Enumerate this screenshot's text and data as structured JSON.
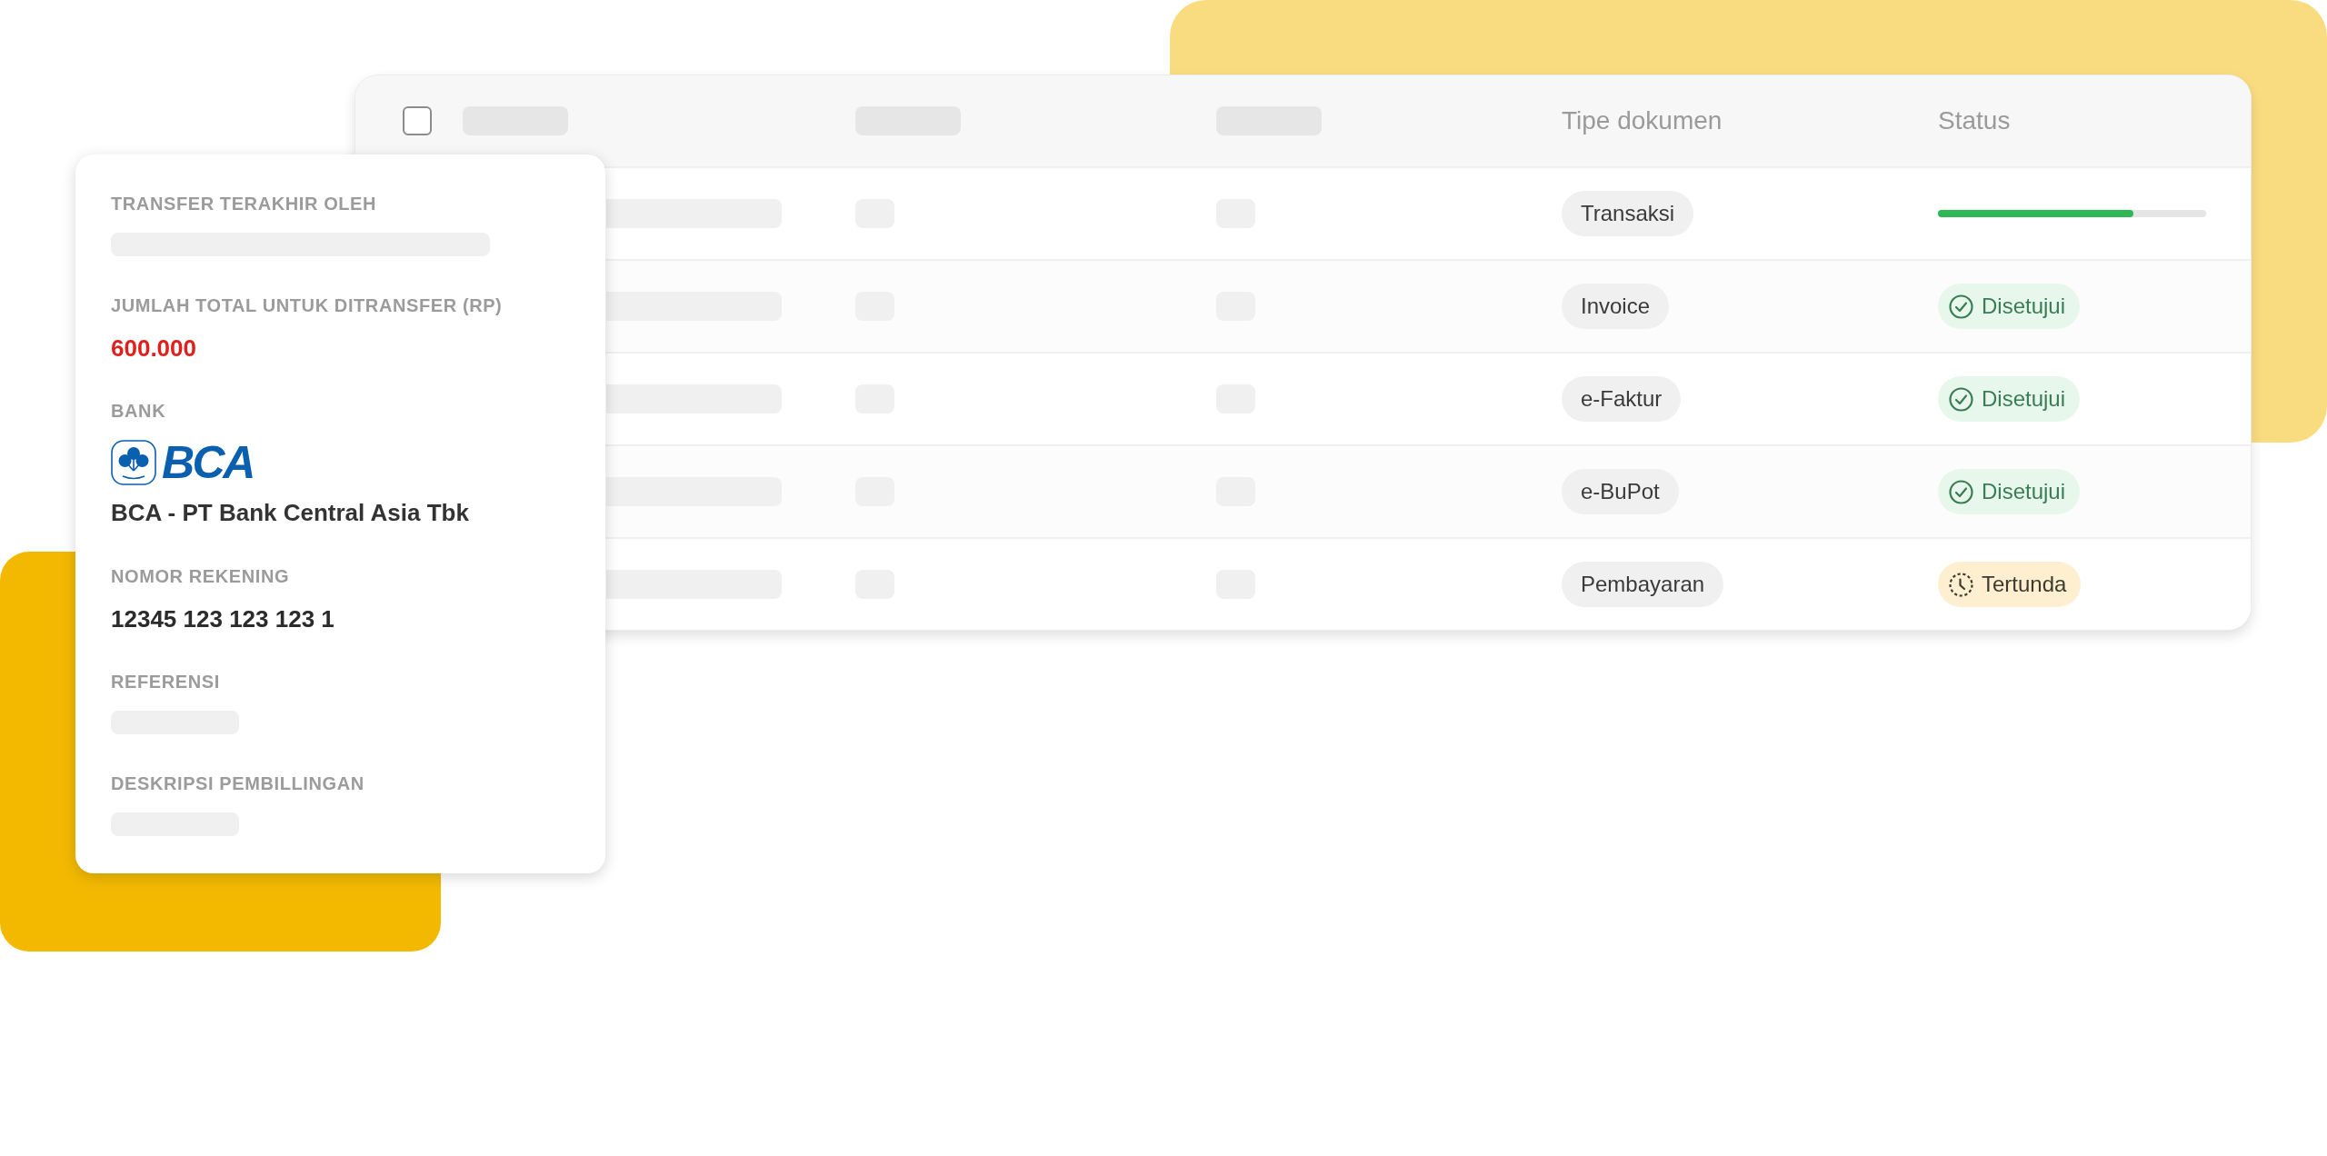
{
  "documents_table": {
    "select_all": {
      "checked": false
    },
    "columns": [
      {
        "kind": "skeleton"
      },
      {
        "kind": "skeleton"
      },
      {
        "kind": "skeleton"
      },
      {
        "kind": "text",
        "label": "Tipe dokumen"
      },
      {
        "kind": "text",
        "label": "Status"
      }
    ],
    "rows": [
      {
        "document_type": "Transaksi",
        "status": {
          "kind": "progress",
          "level": 0.73
        }
      },
      {
        "document_type": "Invoice",
        "status": {
          "kind": "approved",
          "label": "Disetujui"
        }
      },
      {
        "document_type": "e-Faktur",
        "status": {
          "kind": "approved",
          "label": "Disetujui"
        }
      },
      {
        "document_type": "e-BuPot",
        "status": {
          "kind": "approved",
          "label": "Disetujui"
        }
      },
      {
        "document_type": "Pembayaran",
        "status": {
          "kind": "pending",
          "label": "Tertunda"
        }
      }
    ]
  },
  "detail_card": {
    "fields": [
      {
        "kind": "skeleton",
        "label": "TRANSFER TERAKHIR OLEH"
      },
      {
        "kind": "amount",
        "label": "JUMLAH TOTAL UNTUK DITRANSFER (RP)",
        "value": "600.000"
      },
      {
        "kind": "bank",
        "label": "BANK",
        "logo_text": "BCA",
        "value": "BCA - PT Bank Central Asia Tbk"
      },
      {
        "kind": "text",
        "label": "NOMOR REKENING",
        "value": "12345 123 123 123 1"
      },
      {
        "kind": "skeleton",
        "label": "REFERENSI"
      },
      {
        "kind": "skeleton",
        "label": "DESKRIPSI PEMBILLINGAN"
      }
    ]
  }
}
